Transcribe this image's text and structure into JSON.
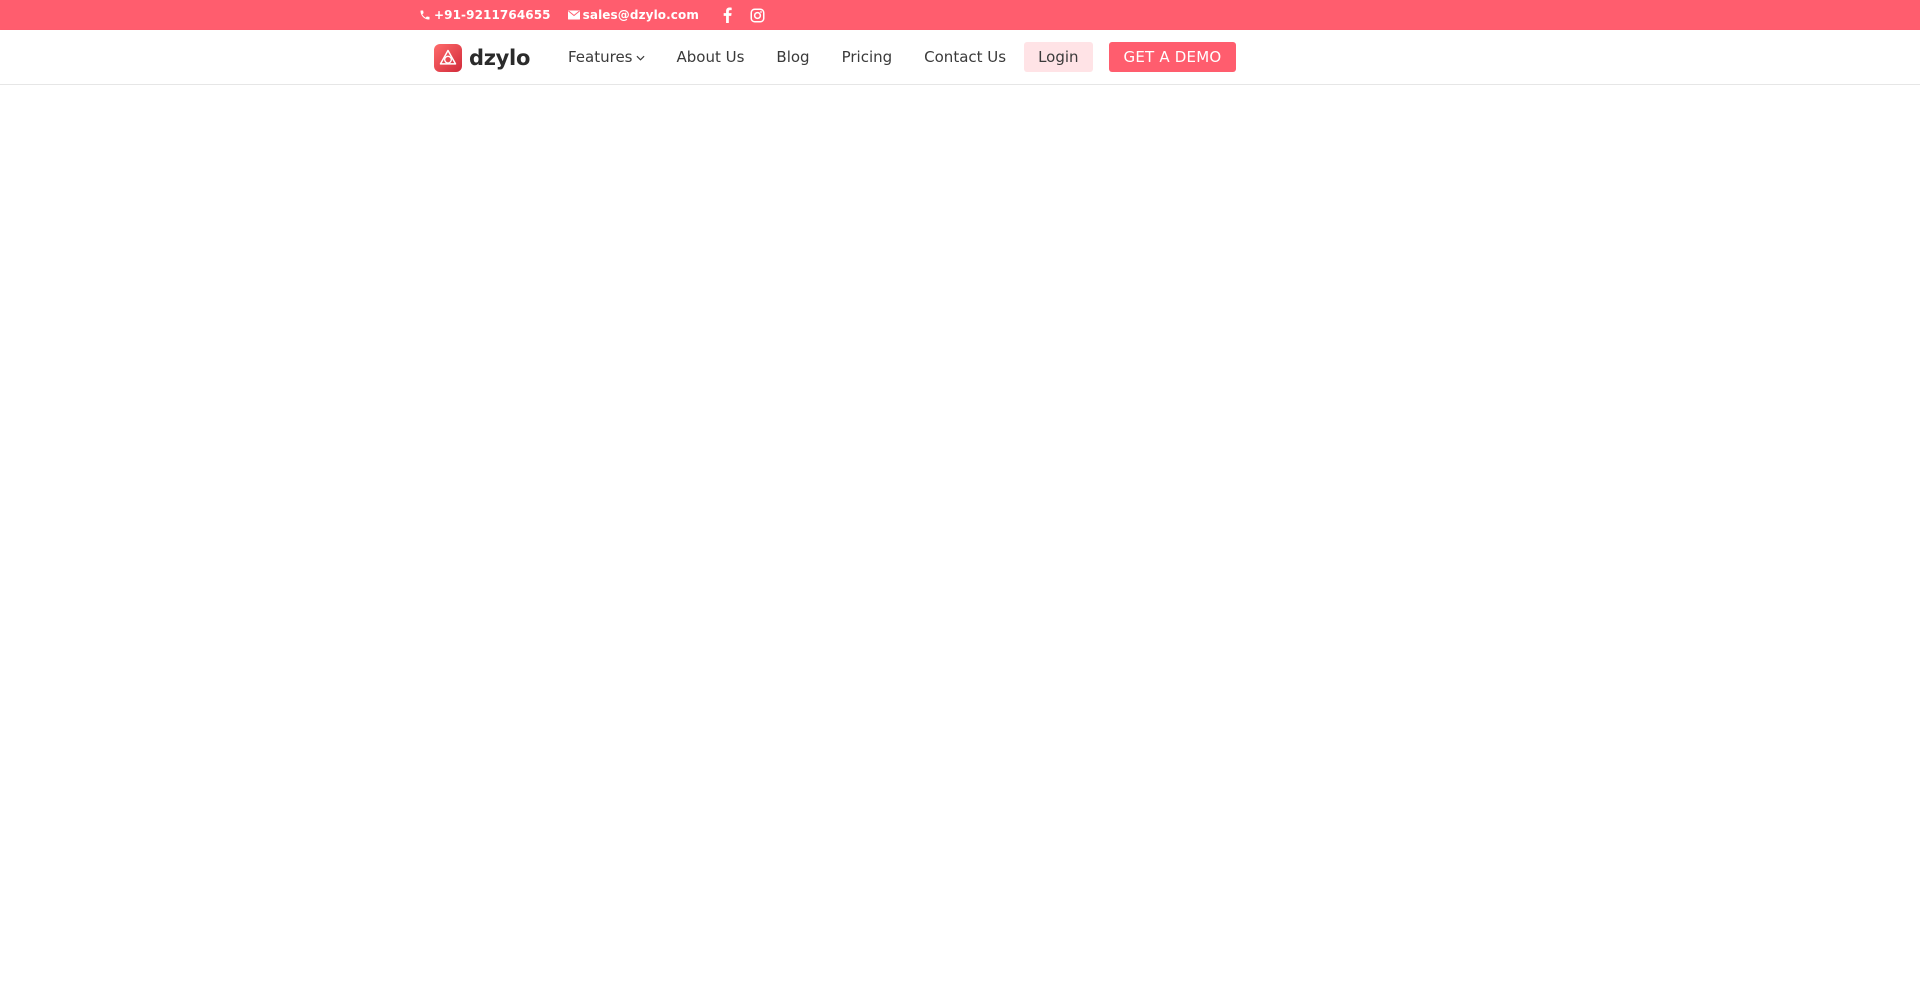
{
  "topbar": {
    "phone": "+91-9211764655",
    "email": "sales@dzylo.com",
    "social": [
      {
        "icon": "facebook-icon"
      },
      {
        "icon": "instagram-icon"
      }
    ],
    "bg_color": "#ff5d6e"
  },
  "header": {
    "logo_text": "dzylo",
    "nav": {
      "features": "Features",
      "about": "About Us",
      "blog": "Blog",
      "pricing": "Pricing",
      "contact": "Contact Us",
      "login": "Login",
      "demo": "GET A DEMO"
    },
    "accent_color": "#ff5d6e",
    "login_bg_color": "#ffe3e6"
  }
}
